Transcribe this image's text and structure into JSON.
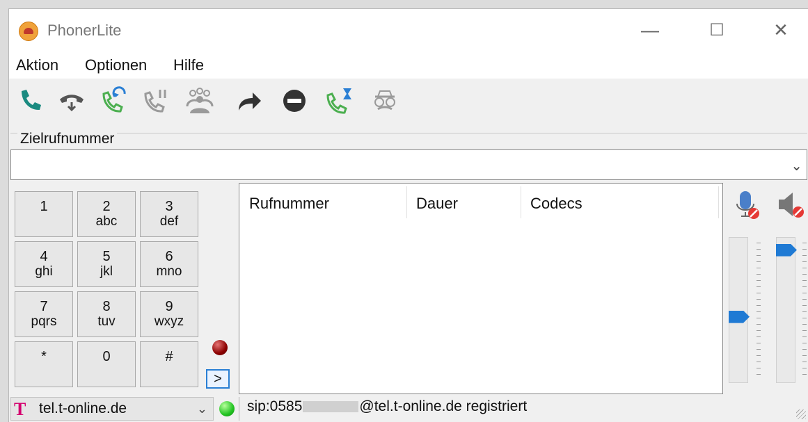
{
  "window": {
    "title": "PhonerLite",
    "minimize": "—",
    "maximize": "☐",
    "close": "✕"
  },
  "menu": [
    "Aktion",
    "Optionen",
    "Hilfe"
  ],
  "toolbar": [
    {
      "icon": "phone-icon",
      "color": "#1a8a80"
    },
    {
      "icon": "hangup-icon",
      "color": "#555555"
    },
    {
      "icon": "callback-icon",
      "color": "#4caf50"
    },
    {
      "icon": "hold-icon",
      "color": "#9a9a9a"
    },
    {
      "icon": "conference-icon",
      "color": "#9a9a9a"
    },
    {
      "icon": "forward-icon",
      "color": "#333333"
    },
    {
      "icon": "reject-icon",
      "color": "#333333"
    },
    {
      "icon": "pending-call-icon",
      "color": "#4caf50"
    },
    {
      "icon": "anonymous-icon",
      "color": "#9a9a9a"
    }
  ],
  "dial": {
    "group_label": "Zielrufnummer",
    "value": "",
    "dropdown_arrow": "⌄"
  },
  "keypad": [
    {
      "main": "1",
      "sub": ""
    },
    {
      "main": "2",
      "sub": "abc"
    },
    {
      "main": "3",
      "sub": "def"
    },
    {
      "main": "4",
      "sub": "ghi"
    },
    {
      "main": "5",
      "sub": "jkl"
    },
    {
      "main": "6",
      "sub": "mno"
    },
    {
      "main": "7",
      "sub": "pqrs"
    },
    {
      "main": "8",
      "sub": "tuv"
    },
    {
      "main": "9",
      "sub": "wxyz"
    },
    {
      "main": "*",
      "sub": ""
    },
    {
      "main": "0",
      "sub": ""
    },
    {
      "main": "#",
      "sub": ""
    }
  ],
  "forward_button": ">",
  "calls": {
    "columns": [
      "Rufnummer",
      "Dauer",
      "Codecs"
    ],
    "rows": []
  },
  "volume": {
    "mic_level": 0.45,
    "speaker_level": 0.95
  },
  "status": {
    "account": "tel.t-online.de",
    "account_arrow": "⌄",
    "logo": "T",
    "sip_prefix": "sip:0585",
    "sip_suffix": "@tel.t-online.de registriert",
    "led_color": "#22c322"
  }
}
